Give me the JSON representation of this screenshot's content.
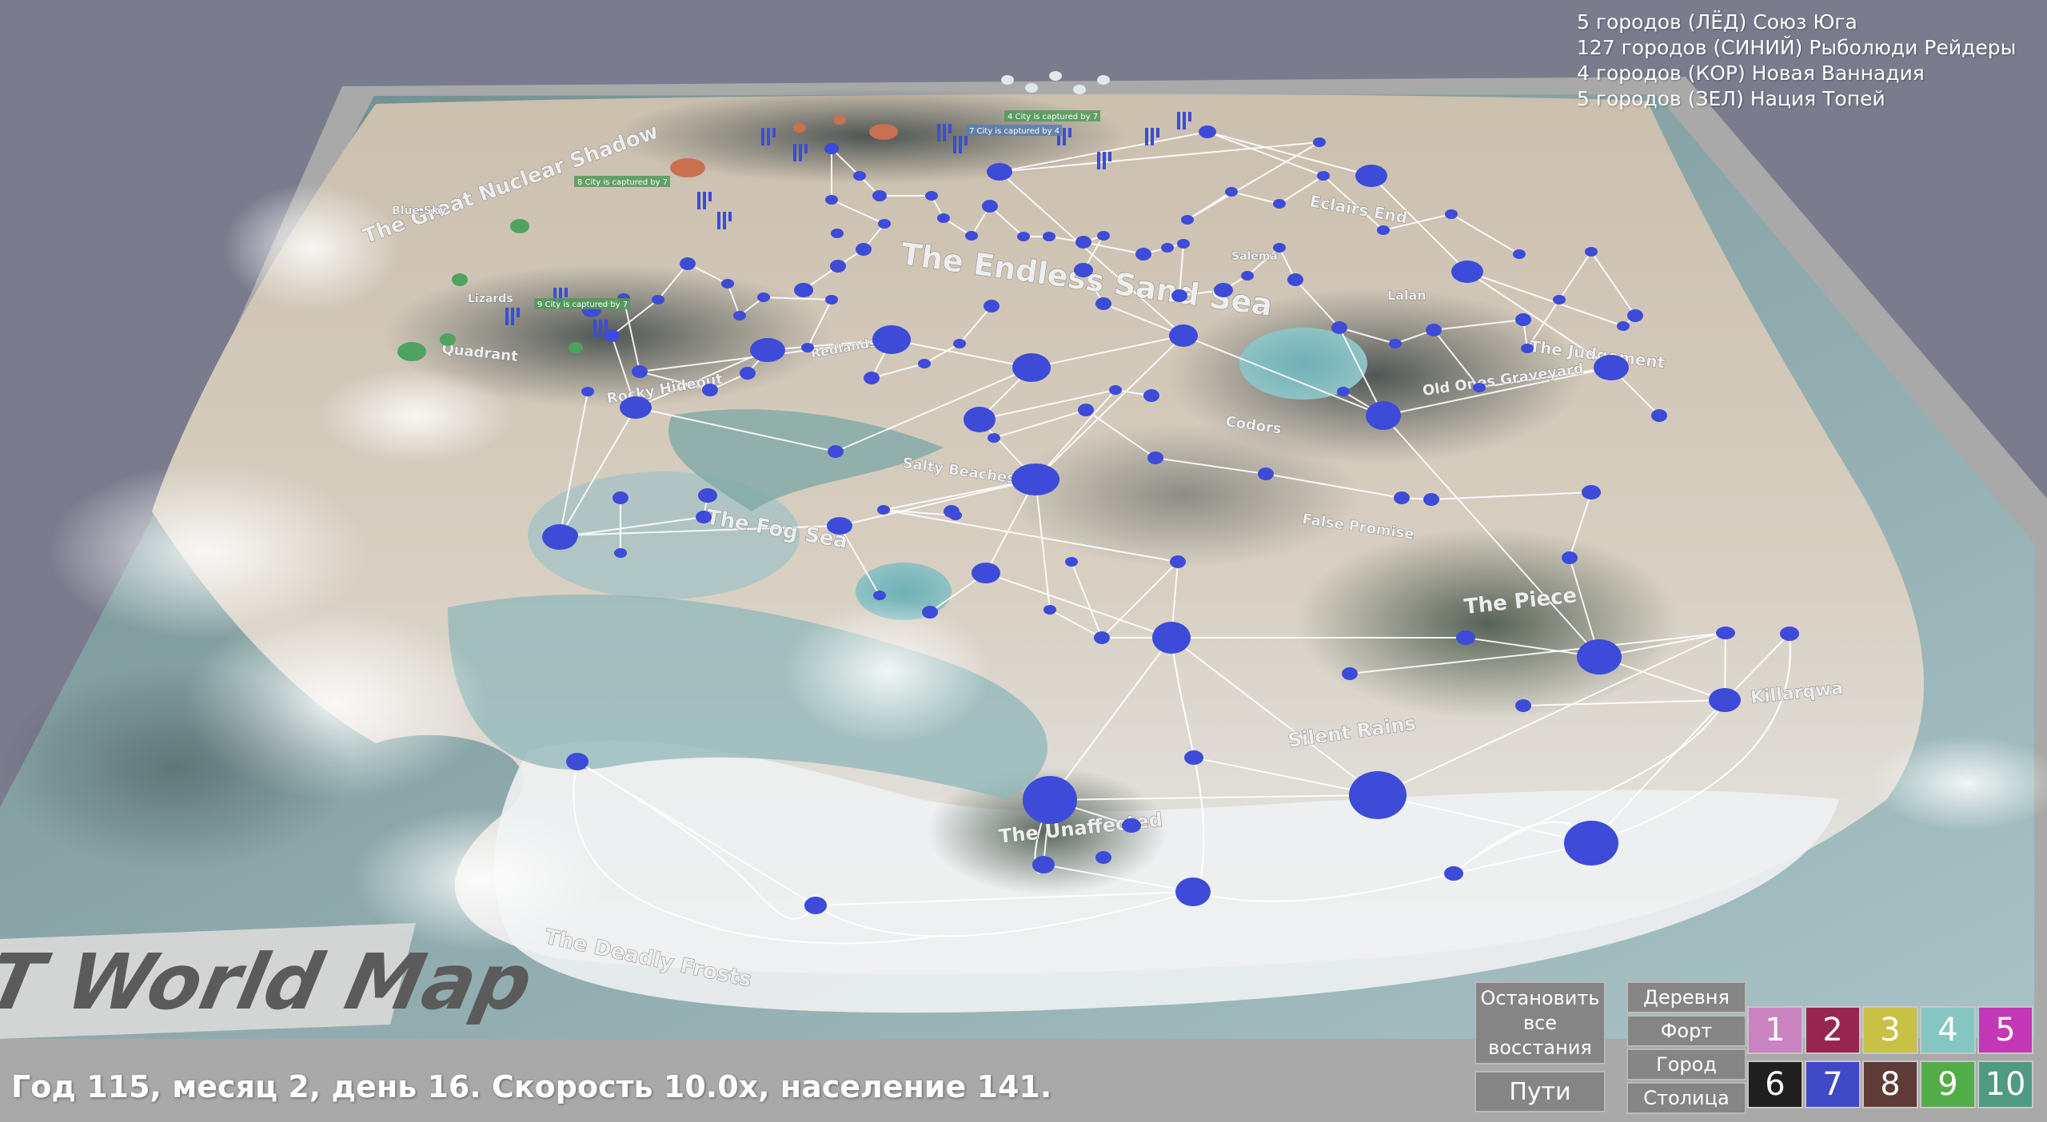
{
  "factions": [
    {
      "text": "5 городов  (ЛЁД) Союз Юга"
    },
    {
      "text": "127 городов  (СИНИЙ) Рыболюди Рейдеры"
    },
    {
      "text": "4 городов  (КОР) Новая Ваннадия"
    },
    {
      "text": "5 городов  (ЗЕЛ) Нация Топей"
    }
  ],
  "status_text": "Год 115, месяц 2, день 16. Скорость  10.0x, население 141.",
  "map": {
    "banner_text": "T World Map",
    "region_labels": [
      {
        "text": "The Great Nuclear Shadow"
      },
      {
        "text": "The Endless Sand Sea"
      },
      {
        "text": "Eclairs End"
      },
      {
        "text": "The Judgement"
      },
      {
        "text": "Old Ones Graveyard"
      },
      {
        "text": "Codors"
      },
      {
        "text": "Salty Beaches"
      },
      {
        "text": "The Fog Sea"
      },
      {
        "text": "False Promise"
      },
      {
        "text": "The Piece"
      },
      {
        "text": "Silent Rains"
      },
      {
        "text": "Killarqwa"
      },
      {
        "text": "The Unaffected"
      },
      {
        "text": "The Deadly Frosts"
      },
      {
        "text": "Quadrant"
      },
      {
        "text": "Rocky Hideout"
      },
      {
        "text": "Redlands"
      },
      {
        "text": "Lalan"
      },
      {
        "text": "Salema"
      },
      {
        "text": "Lizards"
      },
      {
        "text": "Blue Sky"
      }
    ],
    "notifications": [
      {
        "text": "4 City is captured by 7"
      },
      {
        "text": "7 City is captured by 4"
      },
      {
        "text": "8 City is captured by 7"
      },
      {
        "text": "9 City is captured by 7"
      }
    ],
    "colors": {
      "blue_faction": "#3d4bd8",
      "green_faction": "#4ea35f",
      "coral_faction": "#c8704f",
      "road": "#ffffff"
    }
  },
  "controls": {
    "stop_label": "Остановить все восстания",
    "paths_label": "Пути",
    "village_label": "Деревня",
    "fort_label": "Форт",
    "city_label": "Город",
    "capital_label": "Столица"
  },
  "faction_buttons": [
    {
      "label": "1",
      "color": "#c883c0"
    },
    {
      "label": "2",
      "color": "#96264f"
    },
    {
      "label": "3",
      "color": "#c9c145"
    },
    {
      "label": "4",
      "color": "#86c6c2"
    },
    {
      "label": "5",
      "color": "#c437b6"
    },
    {
      "label": "6",
      "color": "#1f1f1f"
    },
    {
      "label": "7",
      "color": "#3f49c6"
    },
    {
      "label": "8",
      "color": "#5f3b38"
    },
    {
      "label": "9",
      "color": "#52ad49"
    },
    {
      "label": "10",
      "color": "#4e9a82"
    }
  ]
}
